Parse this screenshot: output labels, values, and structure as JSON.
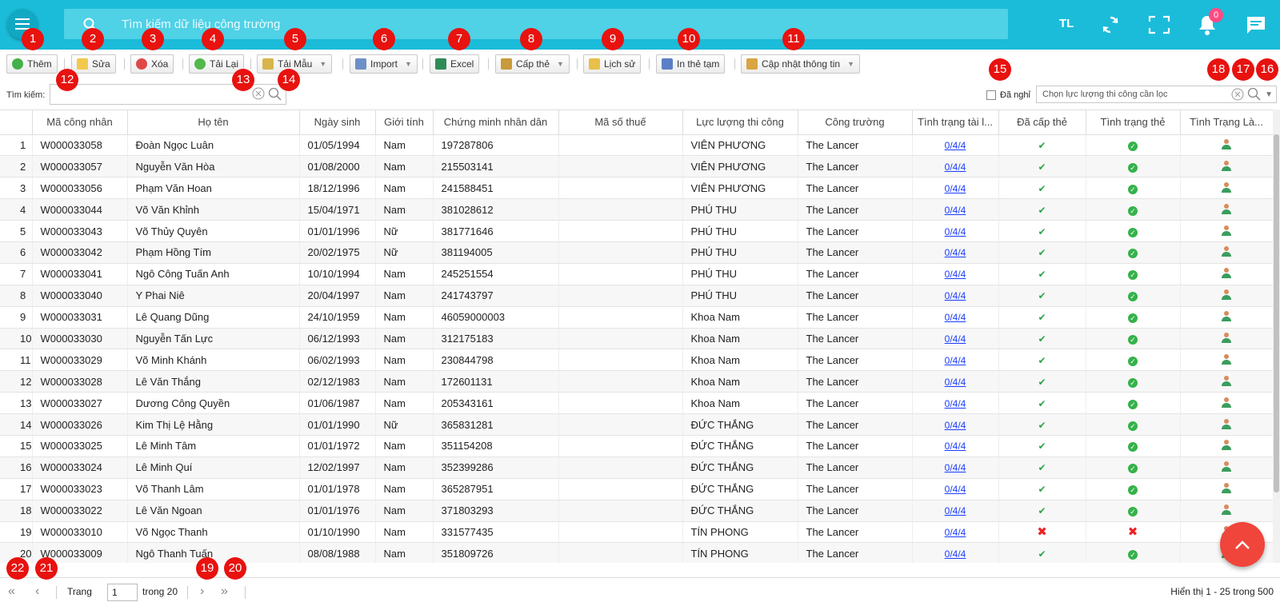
{
  "header": {
    "search_placeholder": "Tìm kiếm dữ liệu công trường",
    "user_initials": "TL",
    "notification_count": "0"
  },
  "toolbar": {
    "buttons": [
      {
        "label": "Thêm",
        "icon": "plus-icon"
      },
      {
        "label": "Sửa",
        "icon": "edit-icon"
      },
      {
        "label": "Xóa",
        "icon": "delete-icon"
      },
      {
        "label": "Tải Lại",
        "icon": "reload-icon"
      },
      {
        "label": "Tải Mẫu",
        "icon": "template-icon"
      },
      {
        "label": "Import",
        "icon": "import-icon"
      },
      {
        "label": "Excel",
        "icon": "excel-icon"
      },
      {
        "label": "Cấp thẻ",
        "icon": "card-icon"
      },
      {
        "label": "Lịch sử",
        "icon": "history-icon"
      },
      {
        "label": "In thẻ tạm",
        "icon": "print-icon"
      },
      {
        "label": "Cập nhật thông tin",
        "icon": "update-icon"
      }
    ]
  },
  "filter": {
    "search_label": "Tìm kiếm:",
    "retired_label": "Đã nghỉ",
    "force_placeholder": "Chọn lực lượng thi công cần lọc"
  },
  "table": {
    "columns": [
      "Mã công nhân",
      "Họ tên",
      "Ngày sinh",
      "Giới tính",
      "Chứng minh nhân dân",
      "Mã số thuế",
      "Lực lượng thi công",
      "Công trường",
      "Tình trạng tài l...",
      "Đã cấp thẻ",
      "Tình trạng thẻ",
      "Tình Trạng Là..."
    ],
    "rows": [
      {
        "no": "1",
        "code": "W000033058",
        "name": "Đoàn Ngọc Luân",
        "dob": "01/05/1994",
        "gender": "Nam",
        "id": "197287806",
        "force": "VIÊN PHƯƠNG",
        "site": "The Lancer",
        "docs": "0/4/4",
        "issued": true,
        "card_ok": true
      },
      {
        "no": "2",
        "code": "W000033057",
        "name": "Nguyễn Văn Hòa",
        "dob": "01/08/2000",
        "gender": "Nam",
        "id": "215503141",
        "force": "VIÊN PHƯƠNG",
        "site": "The Lancer",
        "docs": "0/4/4",
        "issued": true,
        "card_ok": true
      },
      {
        "no": "3",
        "code": "W000033056",
        "name": "Phạm Văn Hoan",
        "dob": "18/12/1996",
        "gender": "Nam",
        "id": "241588451",
        "force": "VIÊN PHƯƠNG",
        "site": "The Lancer",
        "docs": "0/4/4",
        "issued": true,
        "card_ok": true
      },
      {
        "no": "4",
        "code": "W000033044",
        "name": "Võ Văn Khỉnh",
        "dob": "15/04/1971",
        "gender": "Nam",
        "id": "381028612",
        "force": "PHÚ THU",
        "site": "The Lancer",
        "docs": "0/4/4",
        "issued": true,
        "card_ok": true
      },
      {
        "no": "5",
        "code": "W000033043",
        "name": "Võ Thủy Quyên",
        "dob": "01/01/1996",
        "gender": "Nữ",
        "id": "381771646",
        "force": "PHÚ THU",
        "site": "The Lancer",
        "docs": "0/4/4",
        "issued": true,
        "card_ok": true
      },
      {
        "no": "6",
        "code": "W000033042",
        "name": "Phạm Hồng Tím",
        "dob": "20/02/1975",
        "gender": "Nữ",
        "id": "381194005",
        "force": "PHÚ THU",
        "site": "The Lancer",
        "docs": "0/4/4",
        "issued": true,
        "card_ok": true
      },
      {
        "no": "7",
        "code": "W000033041",
        "name": "Ngô Công Tuấn Anh",
        "dob": "10/10/1994",
        "gender": "Nam",
        "id": "245251554",
        "force": "PHÚ THU",
        "site": "The Lancer",
        "docs": "0/4/4",
        "issued": true,
        "card_ok": true
      },
      {
        "no": "8",
        "code": "W000033040",
        "name": "Y Phai Niê",
        "dob": "20/04/1997",
        "gender": "Nam",
        "id": "241743797",
        "force": "PHÚ THU",
        "site": "The Lancer",
        "docs": "0/4/4",
        "issued": true,
        "card_ok": true
      },
      {
        "no": "9",
        "code": "W000033031",
        "name": "Lê Quang Dũng",
        "dob": "24/10/1959",
        "gender": "Nam",
        "id": "46059000003",
        "force": "Khoa Nam",
        "site": "The Lancer",
        "docs": "0/4/4",
        "issued": true,
        "card_ok": true
      },
      {
        "no": "10",
        "code": "W000033030",
        "name": "Nguyễn Tấn Lực",
        "dob": "06/12/1993",
        "gender": "Nam",
        "id": "312175183",
        "force": "Khoa Nam",
        "site": "The Lancer",
        "docs": "0/4/4",
        "issued": true,
        "card_ok": true
      },
      {
        "no": "11",
        "code": "W000033029",
        "name": "Võ Minh Khánh",
        "dob": "06/02/1993",
        "gender": "Nam",
        "id": "230844798",
        "force": "Khoa Nam",
        "site": "The Lancer",
        "docs": "0/4/4",
        "issued": true,
        "card_ok": true
      },
      {
        "no": "12",
        "code": "W000033028",
        "name": "Lê Văn Thắng",
        "dob": "02/12/1983",
        "gender": "Nam",
        "id": "172601131",
        "force": "Khoa Nam",
        "site": "The Lancer",
        "docs": "0/4/4",
        "issued": true,
        "card_ok": true
      },
      {
        "no": "13",
        "code": "W000033027",
        "name": "Dương Công Quyền",
        "dob": "01/06/1987",
        "gender": "Nam",
        "id": "205343161",
        "force": "Khoa Nam",
        "site": "The Lancer",
        "docs": "0/4/4",
        "issued": true,
        "card_ok": true
      },
      {
        "no": "14",
        "code": "W000033026",
        "name": "Kim Thị Lệ Hằng",
        "dob": "01/01/1990",
        "gender": "Nữ",
        "id": "365831281",
        "force": "ĐỨC THẮNG",
        "site": "The Lancer",
        "docs": "0/4/4",
        "issued": true,
        "card_ok": true
      },
      {
        "no": "15",
        "code": "W000033025",
        "name": "Lê Minh Tâm",
        "dob": "01/01/1972",
        "gender": "Nam",
        "id": "351154208",
        "force": "ĐỨC THẮNG",
        "site": "The Lancer",
        "docs": "0/4/4",
        "issued": true,
        "card_ok": true
      },
      {
        "no": "16",
        "code": "W000033024",
        "name": "Lê Minh Quí",
        "dob": "12/02/1997",
        "gender": "Nam",
        "id": "352399286",
        "force": "ĐỨC THẮNG",
        "site": "The Lancer",
        "docs": "0/4/4",
        "issued": true,
        "card_ok": true
      },
      {
        "no": "17",
        "code": "W000033023",
        "name": "Võ Thanh Lâm",
        "dob": "01/01/1978",
        "gender": "Nam",
        "id": "365287951",
        "force": "ĐỨC THẮNG",
        "site": "The Lancer",
        "docs": "0/4/4",
        "issued": true,
        "card_ok": true
      },
      {
        "no": "18",
        "code": "W000033022",
        "name": "Lê Văn Ngoan",
        "dob": "01/01/1976",
        "gender": "Nam",
        "id": "371803293",
        "force": "ĐỨC THẮNG",
        "site": "The Lancer",
        "docs": "0/4/4",
        "issued": true,
        "card_ok": true
      },
      {
        "no": "19",
        "code": "W000033010",
        "name": "Võ Ngọc Thanh",
        "dob": "01/10/1990",
        "gender": "Nam",
        "id": "331577435",
        "force": "TÍN PHONG",
        "site": "The Lancer",
        "docs": "0/4/4",
        "issued": false,
        "card_ok": false
      },
      {
        "no": "20",
        "code": "W000033009",
        "name": "Ngô Thanh Tuấn",
        "dob": "08/08/1988",
        "gender": "Nam",
        "id": "351809726",
        "force": "TÍN PHONG",
        "site": "The Lancer",
        "docs": "0/4/4",
        "issued": true,
        "card_ok": true
      }
    ]
  },
  "pager": {
    "page_label": "Trang",
    "page_value": "1",
    "of_label": "trong 20",
    "info": "Hiển thị 1 - 25 trong 500"
  },
  "badges": [
    "1",
    "2",
    "3",
    "4",
    "5",
    "6",
    "7",
    "8",
    "9",
    "10",
    "11",
    "12",
    "13",
    "14",
    "15",
    "16",
    "17",
    "18",
    "19",
    "20",
    "21",
    "22"
  ],
  "colors": {
    "header": "#1bbcd9",
    "badge": "#e8120f",
    "fab": "#f0453b",
    "link": "#1a3cff"
  }
}
